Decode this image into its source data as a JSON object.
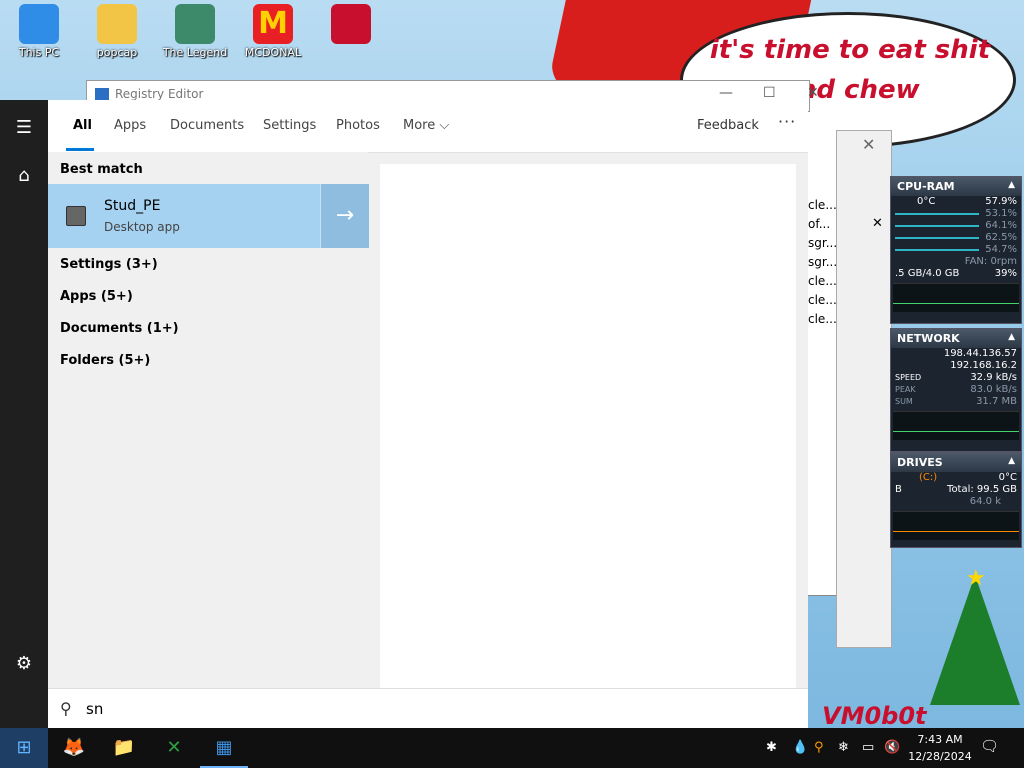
{
  "desktop": {
    "icons": [
      {
        "label": "This PC",
        "icon": "computer-icon",
        "color": "#2f8de8"
      },
      {
        "label": "popcap",
        "icon": "folder-icon",
        "color": "#f3c546"
      },
      {
        "label": "The Legend",
        "icon": "shortcut-icon",
        "color": "#3c8a6a"
      },
      {
        "label": "MCDONAL",
        "icon": "mcdonalds-icon",
        "color": "#e81f23"
      },
      {
        "label": "",
        "icon": "santa-icon",
        "color": "#c8102e"
      }
    ],
    "meme_text": "it's time to eat shit\nand chew",
    "signature": "VM0b0t"
  },
  "registry_editor": {
    "title": "Registry Editor",
    "rows": [
      "cle...",
      "of...",
      "sgr...",
      "sgr...",
      "cle...",
      "cle...",
      "cle..."
    ]
  },
  "gadgets": {
    "cpu": {
      "title": "CPU-RAM",
      "temp": "0°C",
      "total": "57.9%",
      "cores": [
        "53.1%",
        "64.1%",
        "62.5%",
        "54.7%"
      ],
      "fan": "FAN: 0rpm",
      "ram": ".5 GB/4.0 GB",
      "ram_pct": "39%"
    },
    "network": {
      "title": "NETWORK",
      "ip1": "198.44.136.57",
      "ip2": "192.168.16.2",
      "speed_label": "SPEED",
      "speed": "32.9 kB/s",
      "peak_label": "PEAK",
      "peak": "83.0 kB/s",
      "sum_label": "SUM",
      "sum": "31.7 MB"
    },
    "drives": {
      "title": "DRIVES",
      "drive": "(C:)",
      "temp": "0°C",
      "total": "Total: 99.5 GB",
      "io": "64.0 k",
      "left_b": "B"
    }
  },
  "rail": {
    "menu_icon": "☰",
    "home_icon": "⌂",
    "settings_icon": "⚙"
  },
  "search": {
    "tabs": [
      {
        "label": "All",
        "active": true
      },
      {
        "label": "Apps"
      },
      {
        "label": "Documents"
      },
      {
        "label": "Settings"
      },
      {
        "label": "Photos"
      },
      {
        "label": "More"
      }
    ],
    "feedback": "Feedback",
    "more_dots": "···",
    "best_match_heading": "Best match",
    "best_match": {
      "name": "Stud_PE",
      "type": "Desktop app"
    },
    "categories": [
      "Settings (3+)",
      "Apps (5+)",
      "Documents (1+)",
      "Folders (5+)"
    ],
    "query": "sn",
    "accent": "#0078d7"
  },
  "taskbar": {
    "apps": [
      {
        "icon": "firefox-icon",
        "glyph": "🦊"
      },
      {
        "icon": "file-explorer-icon",
        "glyph": "📁"
      },
      {
        "icon": "excel-icon",
        "glyph": "✕"
      },
      {
        "icon": "registry-editor-icon",
        "glyph": "▦"
      }
    ],
    "time": "7:43 AM",
    "date": "12/28/2024"
  }
}
